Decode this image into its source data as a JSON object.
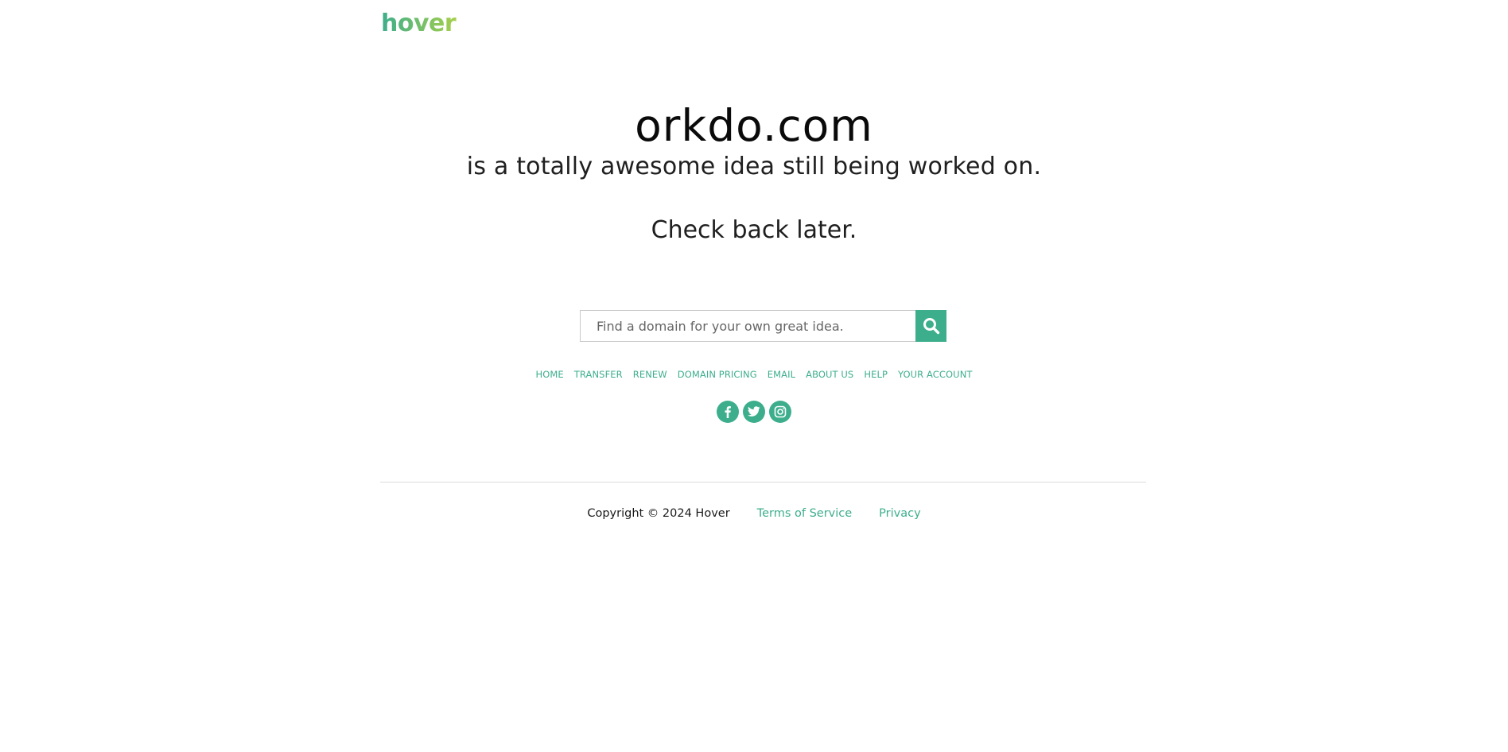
{
  "brand": {
    "logo_text": "hover",
    "accent_color": "#3dae8c",
    "logo_gradient": [
      "#3dae8c",
      "#a6cf4a"
    ]
  },
  "hero": {
    "domain": "orkdo.com",
    "tagline": "is a totally awesome idea still being worked on.",
    "check_back": "Check back later."
  },
  "search": {
    "placeholder": "Find a domain for your own great idea.",
    "value": "",
    "button_icon": "search-icon"
  },
  "nav": {
    "items": [
      {
        "label": "HOME"
      },
      {
        "label": "TRANSFER"
      },
      {
        "label": "RENEW"
      },
      {
        "label": "DOMAIN PRICING"
      },
      {
        "label": "EMAIL"
      },
      {
        "label": "ABOUT US"
      },
      {
        "label": "HELP"
      },
      {
        "label": "YOUR ACCOUNT"
      }
    ]
  },
  "social": {
    "items": [
      {
        "icon": "facebook-icon"
      },
      {
        "icon": "twitter-icon"
      },
      {
        "icon": "instagram-icon"
      }
    ]
  },
  "footer": {
    "copyright": "Copyright © 2024 Hover",
    "terms_label": "Terms of Service",
    "privacy_label": "Privacy"
  }
}
